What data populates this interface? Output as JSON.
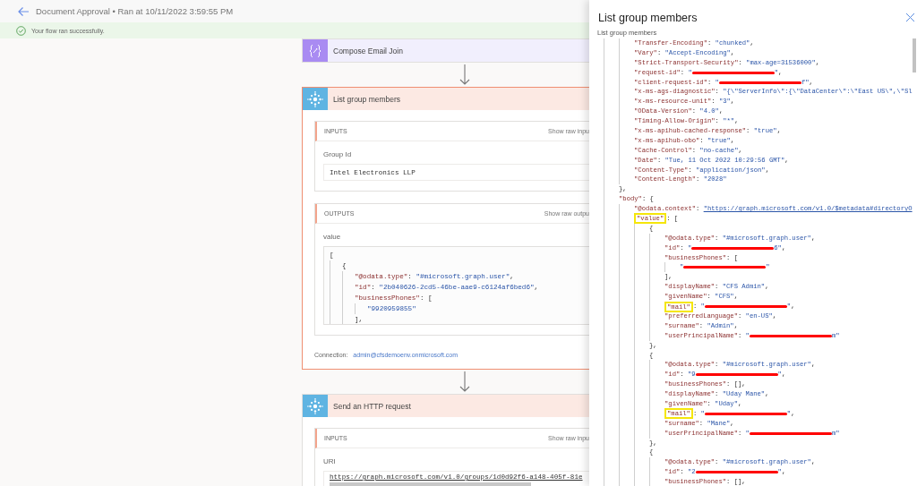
{
  "header": {
    "title": "Document Approval • Ran at 10/11/2022 3:59:55 PM"
  },
  "banner": {
    "message": "Your flow ran successfully."
  },
  "steps": [
    {
      "kind": "compose",
      "title": "Compose Email Join",
      "selected": false
    },
    {
      "kind": "connector",
      "title": "List group members",
      "selected": true,
      "sections": [
        {
          "heading": "INPUTS",
          "action": "Show raw inpu",
          "fields": [
            {
              "label": "Group Id",
              "kind": "text",
              "value": "Intel Electronics LLP"
            }
          ]
        },
        {
          "heading": "OUTPUTS",
          "action": "Show raw outpu",
          "fields": [
            {
              "label": "value",
              "kind": "code",
              "lines": [
                {
                  "parts": [
                    {
                      "kind": "punct",
                      "text": "["
                    }
                  ],
                  "children": [
                    {
                      "parts": [
                        {
                          "kind": "punct",
                          "text": "{"
                        }
                      ],
                      "children": [
                        {
                          "parts": [
                            {
                              "kind": "key",
                              "text": "\"@odata.type\""
                            },
                            {
                              "kind": "punct",
                              "text": ": "
                            },
                            {
                              "kind": "string",
                              "text": "\"#microsoft.graph.user\""
                            },
                            {
                              "kind": "punct",
                              "text": ","
                            }
                          ]
                        },
                        {
                          "parts": [
                            {
                              "kind": "key",
                              "text": "\"id\""
                            },
                            {
                              "kind": "punct",
                              "text": ": "
                            },
                            {
                              "kind": "string",
                              "text": "\"2b040626-2cd5-46be-aae9-c6124af6bed6\""
                            },
                            {
                              "kind": "punct",
                              "text": ","
                            }
                          ]
                        },
                        {
                          "parts": [
                            {
                              "kind": "key",
                              "text": "\"businessPhones\""
                            },
                            {
                              "kind": "punct",
                              "text": ": ["
                            }
                          ],
                          "children": [
                            {
                              "parts": [
                                {
                                  "kind": "string",
                                  "text": "\"9920959855\""
                                }
                              ]
                            }
                          ]
                        },
                        {
                          "parts": [
                            {
                              "kind": "punct",
                              "text": "],"
                            }
                          ]
                        }
                      ]
                    }
                  ]
                }
              ]
            }
          ]
        }
      ],
      "connection": {
        "label": "Connection:",
        "account": "admin@cfsdemoenv.onmicrosoft.com"
      }
    },
    {
      "kind": "connector",
      "title": "Send an HTTP request",
      "selected": false,
      "sections": [
        {
          "heading": "INPUTS",
          "action": "Show raw inpu",
          "fields": [
            {
              "label": "URI",
              "kind": "url",
              "value": "https://graph.microsoft.com/v1.0/groups/1d0d92f6-a148-405f-81e"
            }
          ]
        }
      ]
    }
  ],
  "panel": {
    "title": "List group members",
    "subtitle": "List group members",
    "lines": [
      {
        "children": [
          {
            "parts": [
              {
                "kind": "key",
                "text": "\"Transfer-Encoding\""
              },
              {
                "kind": "punct",
                "text": ": "
              },
              {
                "kind": "string",
                "text": "\"chunked\""
              },
              {
                "kind": "punct",
                "text": ","
              }
            ]
          },
          {
            "parts": [
              {
                "kind": "key",
                "text": "\"Vary\""
              },
              {
                "kind": "punct",
                "text": ": "
              },
              {
                "kind": "string",
                "text": "\"Accept-Encoding\""
              },
              {
                "kind": "punct",
                "text": ","
              }
            ]
          },
          {
            "parts": [
              {
                "kind": "key",
                "text": "\"Strict-Transport-Security\""
              },
              {
                "kind": "punct",
                "text": ": "
              },
              {
                "kind": "string",
                "text": "\"max-age=31536000\""
              },
              {
                "kind": "punct",
                "text": ","
              }
            ]
          },
          {
            "parts": [
              {
                "kind": "key",
                "text": "\"request-id\""
              },
              {
                "kind": "punct",
                "text": ": "
              },
              {
                "kind": "string",
                "text": "\""
              },
              {
                "kind": "redacted"
              },
              {
                "kind": "string",
                "text": "\""
              },
              {
                "kind": "punct",
                "text": ","
              }
            ]
          },
          {
            "parts": [
              {
                "kind": "key",
                "text": "\"client-request-id\""
              },
              {
                "kind": "punct",
                "text": ": "
              },
              {
                "kind": "string",
                "text": "\""
              },
              {
                "kind": "redacted"
              },
              {
                "kind": "string",
                "text": "f\""
              },
              {
                "kind": "punct",
                "text": ","
              }
            ]
          },
          {
            "parts": [
              {
                "kind": "key",
                "text": "\"x-ms-ags-diagnostic\""
              },
              {
                "kind": "punct",
                "text": ": "
              },
              {
                "kind": "string",
                "text": "\"{\\\"ServerInfo\\\":{\\\"DataCenter\\\":\\\"East US\\\",\\\"Sl"
              }
            ]
          },
          {
            "parts": [
              {
                "kind": "key",
                "text": "\"x-ms-resource-unit\""
              },
              {
                "kind": "punct",
                "text": ": "
              },
              {
                "kind": "string",
                "text": "\"3\""
              },
              {
                "kind": "punct",
                "text": ","
              }
            ]
          },
          {
            "parts": [
              {
                "kind": "key",
                "text": "\"OData-Version\""
              },
              {
                "kind": "punct",
                "text": ": "
              },
              {
                "kind": "string",
                "text": "\"4.0\""
              },
              {
                "kind": "punct",
                "text": ","
              }
            ]
          },
          {
            "parts": [
              {
                "kind": "key",
                "text": "\"Timing-Allow-Origin\""
              },
              {
                "kind": "punct",
                "text": ": "
              },
              {
                "kind": "string",
                "text": "\"*\""
              },
              {
                "kind": "punct",
                "text": ","
              }
            ]
          },
          {
            "parts": [
              {
                "kind": "key",
                "text": "\"x-ms-apihub-cached-response\""
              },
              {
                "kind": "punct",
                "text": ": "
              },
              {
                "kind": "string",
                "text": "\"true\""
              },
              {
                "kind": "punct",
                "text": ","
              }
            ]
          },
          {
            "parts": [
              {
                "kind": "key",
                "text": "\"x-ms-apihub-obo\""
              },
              {
                "kind": "punct",
                "text": ": "
              },
              {
                "kind": "string",
                "text": "\"true\""
              },
              {
                "kind": "punct",
                "text": ","
              }
            ]
          },
          {
            "parts": [
              {
                "kind": "key",
                "text": "\"Cache-Control\""
              },
              {
                "kind": "punct",
                "text": ": "
              },
              {
                "kind": "string",
                "text": "\"no-cache\""
              },
              {
                "kind": "punct",
                "text": ","
              }
            ]
          },
          {
            "parts": [
              {
                "kind": "key",
                "text": "\"Date\""
              },
              {
                "kind": "punct",
                "text": ": "
              },
              {
                "kind": "string",
                "text": "\"Tue, 11 Oct 2022 10:29:56 GMT\""
              },
              {
                "kind": "punct",
                "text": ","
              }
            ]
          },
          {
            "parts": [
              {
                "kind": "key",
                "text": "\"Content-Type\""
              },
              {
                "kind": "punct",
                "text": ": "
              },
              {
                "kind": "string",
                "text": "\"application/json\""
              },
              {
                "kind": "punct",
                "text": ","
              }
            ]
          },
          {
            "parts": [
              {
                "kind": "key",
                "text": "\"Content-Length\""
              },
              {
                "kind": "punct",
                "text": ": "
              },
              {
                "kind": "string",
                "text": "\"2028\""
              }
            ]
          }
        ]
      },
      {
        "parts": [
          {
            "kind": "punct",
            "text": "},"
          }
        ]
      },
      {
        "parts": [
          {
            "kind": "key",
            "text": "\"body\""
          },
          {
            "kind": "punct",
            "text": ": {"
          }
        ],
        "children": [
          {
            "parts": [
              {
                "kind": "key",
                "text": "\"@odata.context\""
              },
              {
                "kind": "punct",
                "text": ": "
              },
              {
                "kind": "link",
                "text": "\"https://graph.microsoft.com/v1.0/$metadata#directoryO"
              }
            ]
          },
          {
            "parts": [
              {
                "kind": "marked",
                "text": "\"value\""
              },
              {
                "kind": "punct",
                "text": ": ["
              }
            ],
            "children": [
              {
                "parts": [
                  {
                    "kind": "punct",
                    "text": "{"
                  }
                ],
                "children": [
                  {
                    "parts": [
                      {
                        "kind": "key",
                        "text": "\"@odata.type\""
                      },
                      {
                        "kind": "punct",
                        "text": ": "
                      },
                      {
                        "kind": "string",
                        "text": "\"#microsoft.graph.user\""
                      },
                      {
                        "kind": "punct",
                        "text": ","
                      }
                    ]
                  },
                  {
                    "parts": [
                      {
                        "kind": "key",
                        "text": "\"id\""
                      },
                      {
                        "kind": "punct",
                        "text": ": "
                      },
                      {
                        "kind": "string",
                        "text": "\""
                      },
                      {
                        "kind": "redacted"
                      },
                      {
                        "kind": "string",
                        "text": "6\""
                      },
                      {
                        "kind": "punct",
                        "text": ","
                      }
                    ]
                  },
                  {
                    "parts": [
                      {
                        "kind": "key",
                        "text": "\"businessPhones\""
                      },
                      {
                        "kind": "punct",
                        "text": ": ["
                      }
                    ],
                    "children": [
                      {
                        "parts": [
                          {
                            "kind": "string",
                            "text": "\""
                          },
                          {
                            "kind": "redacted"
                          },
                          {
                            "kind": "string",
                            "text": "\""
                          }
                        ]
                      }
                    ]
                  },
                  {
                    "parts": [
                      {
                        "kind": "punct",
                        "text": "],"
                      }
                    ]
                  },
                  {
                    "parts": [
                      {
                        "kind": "key",
                        "text": "\"displayName\""
                      },
                      {
                        "kind": "punct",
                        "text": ": "
                      },
                      {
                        "kind": "string",
                        "text": "\"CFS Admin\""
                      },
                      {
                        "kind": "punct",
                        "text": ","
                      }
                    ]
                  },
                  {
                    "parts": [
                      {
                        "kind": "key",
                        "text": "\"givenName\""
                      },
                      {
                        "kind": "punct",
                        "text": ": "
                      },
                      {
                        "kind": "string",
                        "text": "\"CFS\""
                      },
                      {
                        "kind": "punct",
                        "text": ","
                      }
                    ]
                  },
                  {
                    "parts": [
                      {
                        "kind": "marked",
                        "text": "\"mail\""
                      },
                      {
                        "kind": "punct",
                        "text": ": "
                      },
                      {
                        "kind": "string",
                        "text": "\""
                      },
                      {
                        "kind": "redacted"
                      },
                      {
                        "kind": "string",
                        "text": "\""
                      },
                      {
                        "kind": "punct",
                        "text": ","
                      }
                    ]
                  },
                  {
                    "parts": [
                      {
                        "kind": "key",
                        "text": "\"preferredLanguage\""
                      },
                      {
                        "kind": "punct",
                        "text": ": "
                      },
                      {
                        "kind": "string",
                        "text": "\"en-US\""
                      },
                      {
                        "kind": "punct",
                        "text": ","
                      }
                    ]
                  },
                  {
                    "parts": [
                      {
                        "kind": "key",
                        "text": "\"surname\""
                      },
                      {
                        "kind": "punct",
                        "text": ": "
                      },
                      {
                        "kind": "string",
                        "text": "\"Admin\""
                      },
                      {
                        "kind": "punct",
                        "text": ","
                      }
                    ]
                  },
                  {
                    "parts": [
                      {
                        "kind": "key",
                        "text": "\"userPrincipalName\""
                      },
                      {
                        "kind": "punct",
                        "text": ": "
                      },
                      {
                        "kind": "string",
                        "text": "\""
                      },
                      {
                        "kind": "redacted"
                      },
                      {
                        "kind": "string",
                        "text": "m\""
                      }
                    ]
                  }
                ]
              },
              {
                "parts": [
                  {
                    "kind": "punct",
                    "text": "},"
                  }
                ]
              },
              {
                "parts": [
                  {
                    "kind": "punct",
                    "text": "{"
                  }
                ],
                "children": [
                  {
                    "parts": [
                      {
                        "kind": "key",
                        "text": "\"@odata.type\""
                      },
                      {
                        "kind": "punct",
                        "text": ": "
                      },
                      {
                        "kind": "string",
                        "text": "\"#microsoft.graph.user\""
                      },
                      {
                        "kind": "punct",
                        "text": ","
                      }
                    ]
                  },
                  {
                    "parts": [
                      {
                        "kind": "key",
                        "text": "\"id\""
                      },
                      {
                        "kind": "punct",
                        "text": ": "
                      },
                      {
                        "kind": "string",
                        "text": "\"9"
                      },
                      {
                        "kind": "redacted"
                      },
                      {
                        "kind": "string",
                        "text": "\""
                      },
                      {
                        "kind": "punct",
                        "text": ","
                      }
                    ]
                  },
                  {
                    "parts": [
                      {
                        "kind": "key",
                        "text": "\"businessPhones\""
                      },
                      {
                        "kind": "punct",
                        "text": ": [],"
                      }
                    ]
                  },
                  {
                    "parts": [
                      {
                        "kind": "key",
                        "text": "\"displayName\""
                      },
                      {
                        "kind": "punct",
                        "text": ": "
                      },
                      {
                        "kind": "string",
                        "text": "\"Uday Mane\""
                      },
                      {
                        "kind": "punct",
                        "text": ","
                      }
                    ]
                  },
                  {
                    "parts": [
                      {
                        "kind": "key",
                        "text": "\"givenName\""
                      },
                      {
                        "kind": "punct",
                        "text": ": "
                      },
                      {
                        "kind": "string",
                        "text": "\"Uday\""
                      },
                      {
                        "kind": "punct",
                        "text": ","
                      }
                    ]
                  },
                  {
                    "parts": [
                      {
                        "kind": "marked",
                        "text": "\"mail\""
                      },
                      {
                        "kind": "punct",
                        "text": ": "
                      },
                      {
                        "kind": "string",
                        "text": "\""
                      },
                      {
                        "kind": "redacted"
                      },
                      {
                        "kind": "string",
                        "text": "\""
                      },
                      {
                        "kind": "punct",
                        "text": ","
                      }
                    ]
                  },
                  {
                    "parts": [
                      {
                        "kind": "key",
                        "text": "\"surname\""
                      },
                      {
                        "kind": "punct",
                        "text": ": "
                      },
                      {
                        "kind": "string",
                        "text": "\"Mane\""
                      },
                      {
                        "kind": "punct",
                        "text": ","
                      }
                    ]
                  },
                  {
                    "parts": [
                      {
                        "kind": "key",
                        "text": "\"userPrincipalName\""
                      },
                      {
                        "kind": "punct",
                        "text": ": "
                      },
                      {
                        "kind": "string",
                        "text": "\""
                      },
                      {
                        "kind": "redacted"
                      },
                      {
                        "kind": "string",
                        "text": "m\""
                      }
                    ]
                  }
                ]
              },
              {
                "parts": [
                  {
                    "kind": "punct",
                    "text": "},"
                  }
                ]
              },
              {
                "parts": [
                  {
                    "kind": "punct",
                    "text": "{"
                  }
                ],
                "children": [
                  {
                    "parts": [
                      {
                        "kind": "key",
                        "text": "\"@odata.type\""
                      },
                      {
                        "kind": "punct",
                        "text": ": "
                      },
                      {
                        "kind": "string",
                        "text": "\"#microsoft.graph.user\""
                      },
                      {
                        "kind": "punct",
                        "text": ","
                      }
                    ]
                  },
                  {
                    "parts": [
                      {
                        "kind": "key",
                        "text": "\"id\""
                      },
                      {
                        "kind": "punct",
                        "text": ": "
                      },
                      {
                        "kind": "string",
                        "text": "\"2"
                      },
                      {
                        "kind": "redacted"
                      },
                      {
                        "kind": "string",
                        "text": "\""
                      },
                      {
                        "kind": "punct",
                        "text": ","
                      }
                    ]
                  },
                  {
                    "parts": [
                      {
                        "kind": "key",
                        "text": "\"businessPhones\""
                      },
                      {
                        "kind": "punct",
                        "text": ": [],"
                      }
                    ]
                  }
                ]
              }
            ]
          }
        ]
      }
    ]
  }
}
